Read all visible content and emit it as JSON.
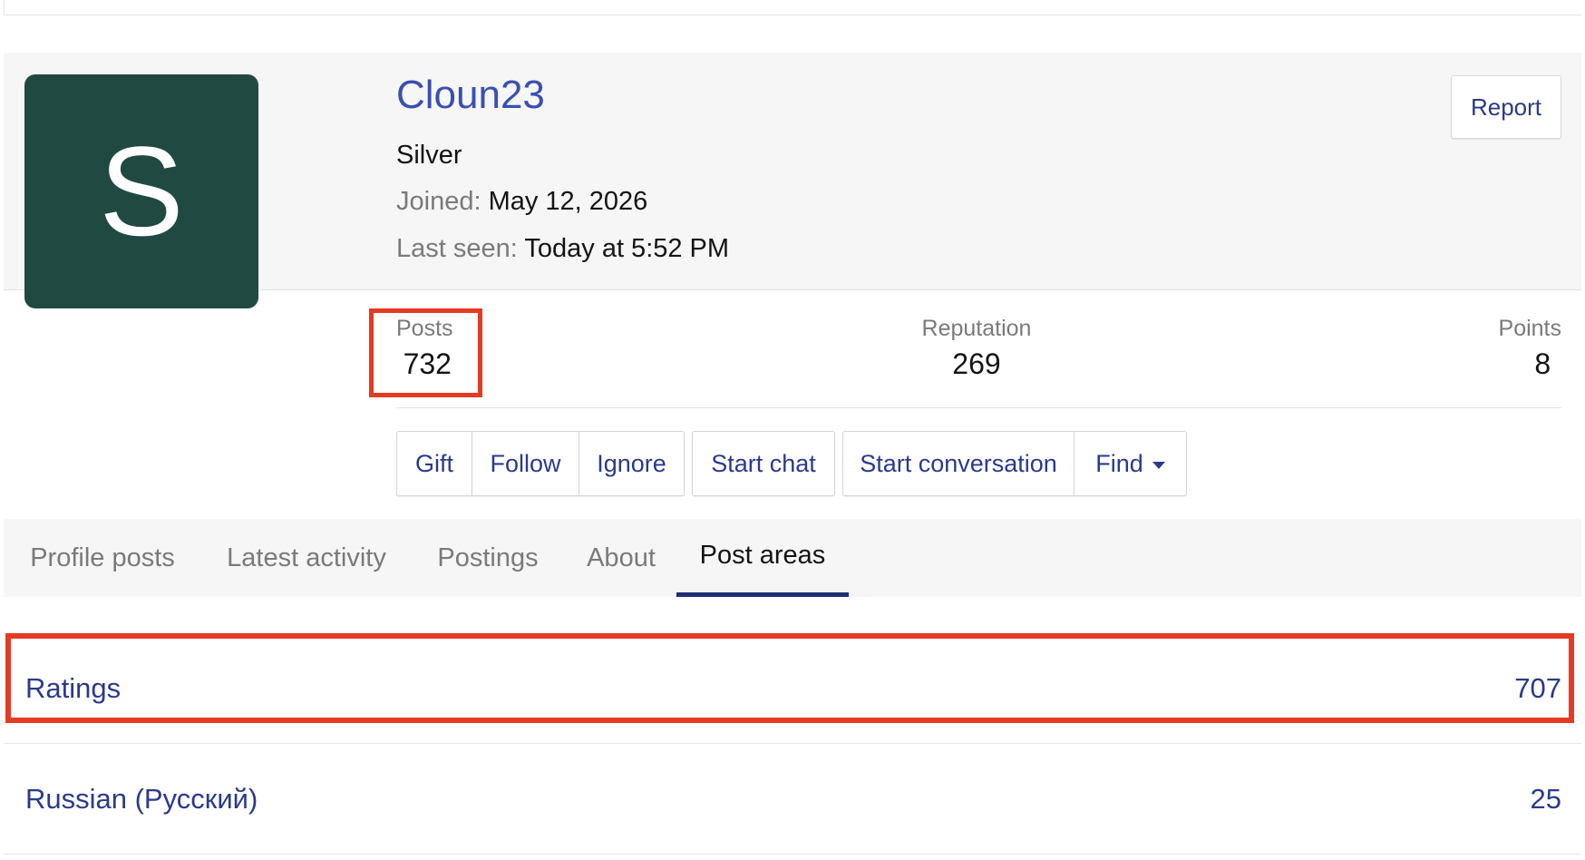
{
  "profile": {
    "avatar_letter": "S",
    "username": "Cloun23",
    "user_title": "Silver",
    "joined_label": "Joined:",
    "joined_value": "May 12, 2026",
    "last_seen_label": "Last seen:",
    "last_seen_value": "Today at 5:52 PM",
    "report_label": "Report",
    "avatar_color": "#204a41",
    "username_color": "#3a4fb0"
  },
  "stats": {
    "posts_label": "Posts",
    "posts_value": "732",
    "reputation_label": "Reputation",
    "reputation_value": "269",
    "points_label": "Points",
    "points_value": "8"
  },
  "actions": {
    "gift": "Gift",
    "follow": "Follow",
    "ignore": "Ignore",
    "start_chat": "Start chat",
    "start_conversation": "Start conversation",
    "find": "Find"
  },
  "tabs": [
    {
      "label": "Profile posts"
    },
    {
      "label": "Latest activity"
    },
    {
      "label": "Postings"
    },
    {
      "label": "About"
    },
    {
      "label": "Post areas"
    }
  ],
  "active_tab": "Post areas",
  "post_areas": [
    {
      "name": "Ratings",
      "count": "707"
    },
    {
      "name": "Russian (Русский)",
      "count": "25"
    }
  ],
  "colors": {
    "highlight": "#e53a23",
    "link": "#2b3a8a",
    "tab_underline": "#1f2f72"
  }
}
